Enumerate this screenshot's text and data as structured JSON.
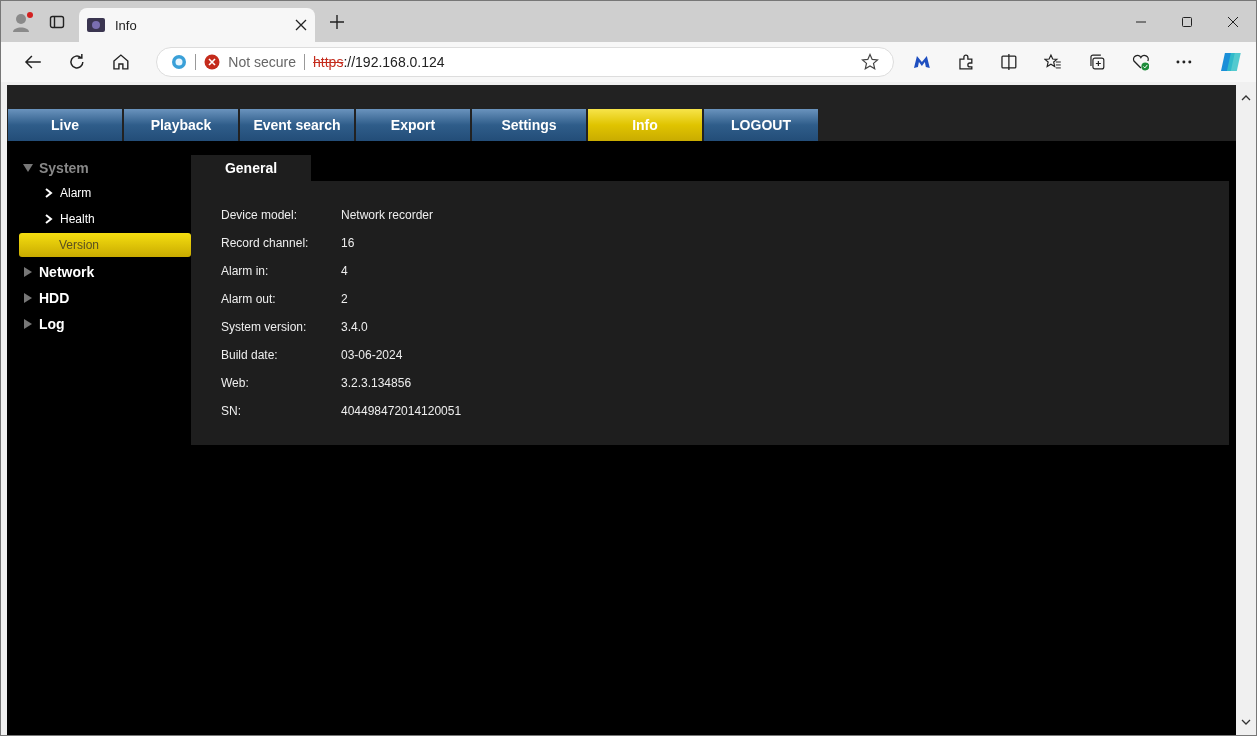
{
  "browser": {
    "tab_title": "Info",
    "security": "Not secure",
    "url_scheme": "https",
    "url_rest": "://192.168.0.124"
  },
  "nav_tabs": [
    {
      "label": "Live",
      "selected": false
    },
    {
      "label": "Playback",
      "selected": false
    },
    {
      "label": "Event search",
      "selected": false
    },
    {
      "label": "Export",
      "selected": false
    },
    {
      "label": "Settings",
      "selected": false
    },
    {
      "label": "Info",
      "selected": true
    },
    {
      "label": "LOGOUT",
      "selected": false
    }
  ],
  "sidebar": {
    "items": [
      {
        "label": "System",
        "expanded": true,
        "children": [
          {
            "label": "Alarm",
            "selected": false
          },
          {
            "label": "Health",
            "selected": false
          },
          {
            "label": "Version",
            "selected": true
          }
        ]
      },
      {
        "label": "Network",
        "expanded": false
      },
      {
        "label": "HDD",
        "expanded": false
      },
      {
        "label": "Log",
        "expanded": false
      }
    ]
  },
  "panel": {
    "tab": "General",
    "rows": [
      {
        "label": "Device model:",
        "value": "Network recorder"
      },
      {
        "label": "Record channel:",
        "value": "16"
      },
      {
        "label": "Alarm in:",
        "value": "4"
      },
      {
        "label": "Alarm out:",
        "value": "2"
      },
      {
        "label": "System version:",
        "value": "3.4.0"
      },
      {
        "label": "Build date:",
        "value": "03-06-2024"
      },
      {
        "label": "Web:",
        "value": "3.2.3.134856"
      },
      {
        "label": "SN:",
        "value": "404498472014120051"
      }
    ]
  }
}
